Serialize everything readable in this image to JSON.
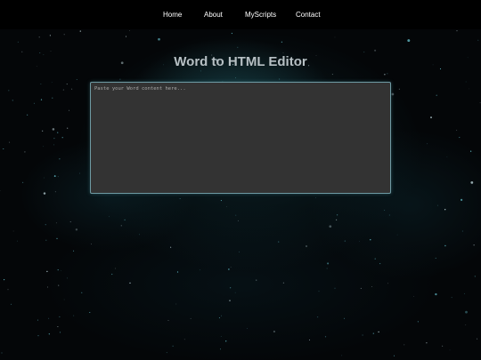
{
  "nav": {
    "items": [
      {
        "label": "Home"
      },
      {
        "label": "About"
      },
      {
        "label": "MyScripts"
      },
      {
        "label": "Contact"
      }
    ]
  },
  "main": {
    "title": "Word to HTML Editor",
    "editor": {
      "value": "",
      "placeholder": "Paste your Word content here..."
    }
  },
  "theme": {
    "nav_background": "#000000",
    "page_background": "#040608",
    "nebula_accent": "#286e78",
    "editor_background": "#333333",
    "editor_border": "#6e9aa3",
    "title_color": "#b7c0c4"
  }
}
